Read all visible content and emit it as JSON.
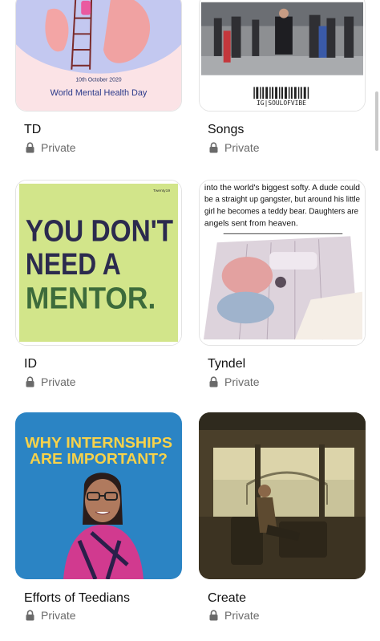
{
  "boards": [
    {
      "title": "TD",
      "privacy": "Private",
      "thumb": {
        "date": "10th October 2020",
        "caption": "World Mental Health Day"
      }
    },
    {
      "title": "Songs",
      "privacy": "Private",
      "thumb": {
        "barcode_text": "IG|SOULOFVIBE"
      }
    },
    {
      "title": "ID",
      "privacy": "Private",
      "thumb": {
        "brand": "Twenty19",
        "line1": "YOU DON'T",
        "line2": "NEED A",
        "line3": "MENTOR."
      }
    },
    {
      "title": "Tyndel",
      "privacy": "Private",
      "thumb": {
        "quote_lines": [
          "into the world's biggest softy. A dude could",
          "be a straight up gangster, but around his little",
          "girl he becomes a teddy bear. Daughters are",
          "angels sent from heaven."
        ]
      }
    },
    {
      "title": "Efforts of Teedians",
      "privacy": "Private",
      "thumb": {
        "line1": "WHY INTERNSHIPS",
        "line2": "ARE IMPORTANT?"
      }
    },
    {
      "title": "Create",
      "privacy": "Private",
      "thumb": {}
    }
  ],
  "colors": {
    "title": "#111111",
    "muted": "#6a6a6a"
  },
  "icons": {
    "privacy": "lock-icon"
  }
}
